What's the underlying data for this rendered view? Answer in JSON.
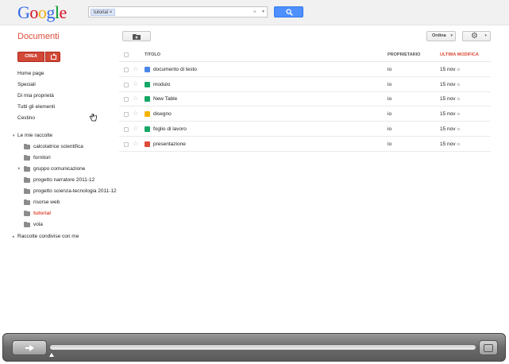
{
  "header": {
    "logo_letters": [
      {
        "ch": "G",
        "color": "#3369e8"
      },
      {
        "ch": "o",
        "color": "#d50f25"
      },
      {
        "ch": "o",
        "color": "#eeb211"
      },
      {
        "ch": "g",
        "color": "#3369e8"
      },
      {
        "ch": "l",
        "color": "#009925"
      },
      {
        "ch": "e",
        "color": "#d50f25"
      }
    ],
    "search_chip": "tutorial",
    "search_chip_close": "×",
    "search_clear": "×",
    "search_dropdown": "▾"
  },
  "toolbar": {
    "app_title": "Documenti",
    "sort_label": "Ordina",
    "caret": "▾",
    "gear": "⚙"
  },
  "create": {
    "label": "CREA"
  },
  "nav": {
    "items": [
      "Home page",
      "Speciali",
      "Di mia proprietà",
      "Tutti gli elementi",
      "Cestino"
    ],
    "my_collections_label": "Le mie raccolte",
    "shared_collections_label": "Raccolte condivise con me",
    "expanded_tri": "▾",
    "collapsed_tri": "▸",
    "folders": [
      {
        "name": "calcolatrice scientifica",
        "has_children": false,
        "active": false
      },
      {
        "name": "fornitori",
        "has_children": false,
        "active": false
      },
      {
        "name": "gruppo comunicazione",
        "has_children": true,
        "active": false
      },
      {
        "name": "progetto narratore 2011-12",
        "has_children": false,
        "active": false
      },
      {
        "name": "progetto scienza-tecnologia 2011-12",
        "has_children": false,
        "active": false
      },
      {
        "name": "risorse web",
        "has_children": false,
        "active": false
      },
      {
        "name": "tutorial",
        "has_children": false,
        "active": true
      },
      {
        "name": "vola",
        "has_children": false,
        "active": false
      }
    ]
  },
  "table": {
    "headers": {
      "title": "TITOLO",
      "owner": "PROPRIETARIO",
      "modified": "ULTIMA MODIFICA"
    },
    "star_glyph": "☆",
    "rows": [
      {
        "name": "documento di testo",
        "type": "document-icon",
        "color": "#4a86e8",
        "owner": "io",
        "modified": "15 nov",
        "by": "io"
      },
      {
        "name": "modulo",
        "type": "form-icon",
        "color": "#16a765",
        "owner": "io",
        "modified": "15 nov",
        "by": "io"
      },
      {
        "name": "New Table",
        "type": "table-icon",
        "color": "#16a765",
        "owner": "io",
        "modified": "15 nov",
        "by": "io"
      },
      {
        "name": "disegno",
        "type": "drawing-icon",
        "color": "#f4b400",
        "owner": "io",
        "modified": "15 nov",
        "by": "io"
      },
      {
        "name": "foglio di lavoro",
        "type": "spreadsheet-icon",
        "color": "#16a765",
        "owner": "io",
        "modified": "15 nov",
        "by": "io"
      },
      {
        "name": "presentazione",
        "type": "presentation-icon",
        "color": "#dd4b39",
        "owner": "io",
        "modified": "15 nov",
        "by": "io"
      }
    ]
  },
  "player": {
    "progress": 0.0
  }
}
